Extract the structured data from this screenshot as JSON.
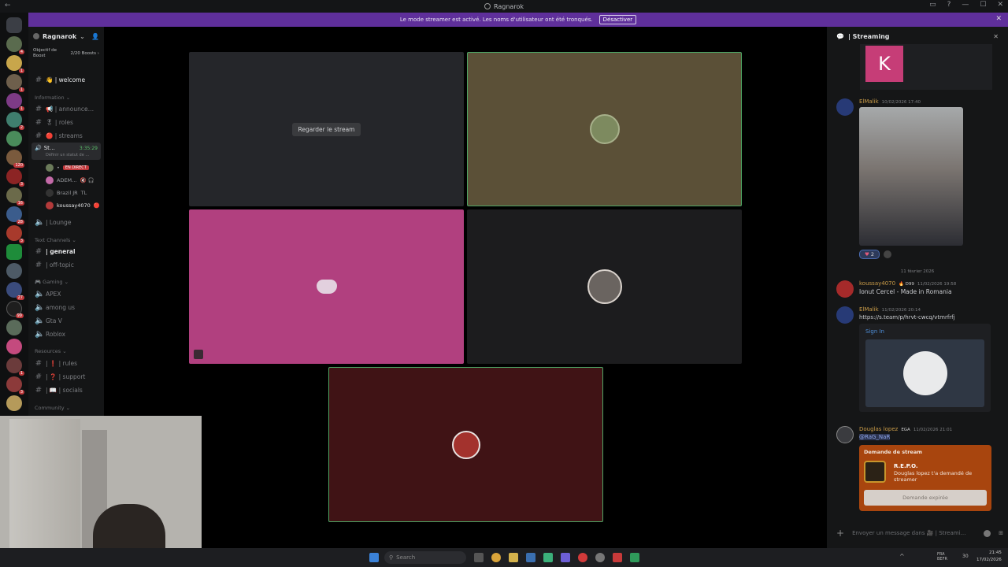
{
  "window": {
    "title": "Ragnarok",
    "back_glyph": "←",
    "controls": [
      "▭",
      "?",
      "—",
      "☐",
      "✕"
    ]
  },
  "banner": {
    "text": "Le mode streamer est activé. Les noms d'utilisateur ont été tronqués.",
    "button": "Désactiver",
    "close": "✕"
  },
  "guild_badges": [
    "4",
    "1",
    "1",
    "1",
    "2",
    "120",
    "3",
    "16",
    "28",
    "3",
    "27",
    "99",
    "1",
    "3"
  ],
  "server": {
    "name": "Ragnarok",
    "boost_label": "Objectif de Boost",
    "boost_count": "2/20 Boosts",
    "boost_chevron": "›"
  },
  "channels": {
    "welcome": "👋 | welcome",
    "cat_information": "Information ⌄",
    "announcements": "📢 | announce…",
    "roles": "🎖 | roles",
    "streams": "🔴 | streams",
    "streaming_channel": "St…",
    "streaming_time": "3:35:29",
    "status_hint": "Définir un statut de …",
    "voice_users": [
      {
        "name": "•",
        "tag": "EN DIRECT"
      },
      {
        "name": "ADEM…",
        "tag": "🔇 🎧"
      },
      {
        "name": "Brazil JR",
        "tag": "TL"
      },
      {
        "name": "koussay4070",
        "tag": "🔴"
      }
    ],
    "lounge": "| Lounge",
    "cat_text": "Text Channels ⌄",
    "general": "| general",
    "off_topic": "| off-topic",
    "cat_gaming": "🎮 Gaming ⌄",
    "apex": "APEX",
    "among_us": "among us",
    "gta": "Gta V",
    "roblox": "Roblox",
    "cat_resources": "Resources ⌄",
    "rules": "| ❗ | rules",
    "support": "| ❓ | support",
    "socials": "| 📖 | socials",
    "cat_community": "Community ⌄"
  },
  "stage": {
    "watch_stream": "Regarder le stream"
  },
  "panel": {
    "title": "| Streaming",
    "close": "✕",
    "tile_letter": "K",
    "msg1": {
      "author": "ElMalik",
      "time": "10/02/2026 17:40",
      "reaction": "2"
    },
    "date_sep": "11 février 2026",
    "msg2": {
      "author": "koussay4070",
      "badge": "🔥 D99",
      "time": "11/02/2026 19:58",
      "text": "Ionut Cercel - Made in Romania"
    },
    "msg3": {
      "author": "ElMalik",
      "time": "11/02/2026 20:14",
      "link": "https://s.team/p/hrvt-cwcq/vtmrfrfj",
      "embed_title": "Sign In"
    },
    "msg4": {
      "author": "Douglas lopez",
      "badge": "EGA",
      "time": "11/02/2026 21:01",
      "mention": "@RaG_NaR",
      "card_title": "Demande de stream",
      "game": "R.E.P.O.",
      "card_text": "Douglas lopez t'a demandé de streamer",
      "card_button": "Demande expirée"
    },
    "input_placeholder": "Envoyer un message dans 🎥 | Streami…"
  },
  "taskbar": {
    "search": "Search",
    "lang": "FRA BEFR",
    "volume": "30",
    "time": "21:45",
    "date": "17/02/2026"
  }
}
